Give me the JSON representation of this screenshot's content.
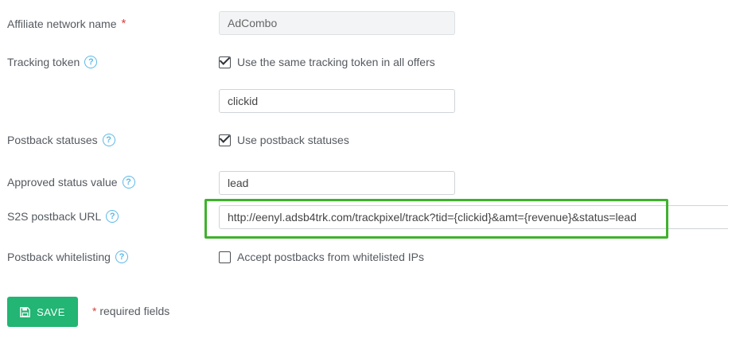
{
  "fields": {
    "affiliate_network_name": {
      "label": "Affiliate network name",
      "required_mark": "*",
      "value": "AdCombo"
    },
    "tracking_token": {
      "label": "Tracking token",
      "help": "?",
      "checkbox_label": "Use the same tracking token in all offers",
      "checked": true,
      "value": "clickid"
    },
    "postback_statuses": {
      "label": "Postback statuses",
      "help": "?",
      "checkbox_label": "Use postback statuses",
      "checked": true
    },
    "approved_status_value": {
      "label": "Approved status value",
      "help": "?",
      "value": "lead"
    },
    "s2s_postback_url": {
      "label": "S2S postback URL",
      "help": "?",
      "value": "http://eenyl.adsb4trk.com/trackpixel/track?tid={clickid}&amt={revenue}&status=lead"
    },
    "postback_whitelisting": {
      "label": "Postback whitelisting",
      "help": "?",
      "checkbox_label": "Accept postbacks from whitelisted IPs",
      "checked": false
    }
  },
  "footer": {
    "save_label": "SAVE",
    "required_star": "*",
    "required_note": "required fields"
  },
  "colors": {
    "accent_green": "#22b573",
    "highlight_green": "#3fb22c",
    "help_blue": "#5bb8e8",
    "required_red": "#e03c3c"
  },
  "icons": {
    "help": "question-circle-icon",
    "save": "floppy-disk-icon",
    "check": "checkbox-check-icon"
  }
}
